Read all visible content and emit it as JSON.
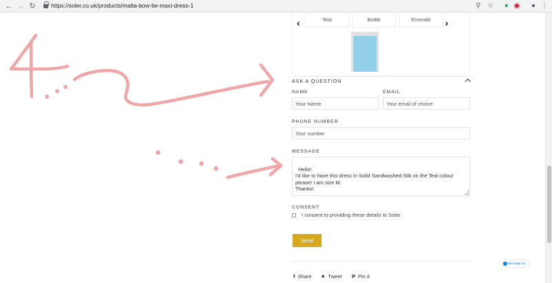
{
  "browser": {
    "url": "https://soler.co.uk/products/malta-bow-tie-maxi-dress-1",
    "back_icon": "arrow-left",
    "forward_icon": "arrow-right",
    "reload_icon": "reload"
  },
  "carousel": {
    "swatches": [
      "Teal",
      "Bottle",
      "Emerald"
    ],
    "swatch_colour": "#92cfe8"
  },
  "form": {
    "section_title": "ASK A QUESTION",
    "name_label": "NAME",
    "name_placeholder": "Your Name",
    "email_label": "EMAIL",
    "email_placeholder": "Your email of choice",
    "phone_label": "PHONE NUMBER",
    "phone_placeholder": "Your number",
    "message_label": "MESSAGE",
    "message_value": "Hello!\nI'd like to have this dress in Solid Sandwashed Silk on the Teal colour please! I am size M.\nThanks!",
    "consent_label": "CONSENT",
    "consent_text": "I consent to providing these details to Soler",
    "send_label": "Send",
    "accent": "#d6a81d"
  },
  "share": {
    "share_label": "Share",
    "tweet_label": "Tweet",
    "pin_label": "Pin it"
  },
  "messenger": {
    "label": "Message Us"
  },
  "annotation": {
    "color": "#f0a6a6"
  }
}
